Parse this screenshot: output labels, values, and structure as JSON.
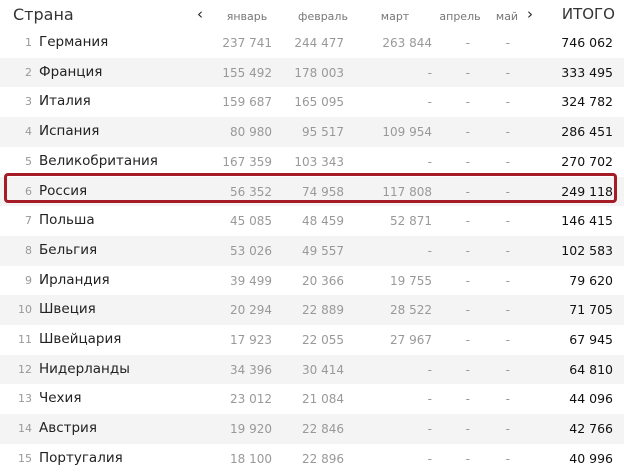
{
  "header": {
    "country": "Страна",
    "months": [
      "январь",
      "февраль",
      "март",
      "апрель",
      "май"
    ],
    "total": "ИТОГО",
    "prev_icon": "chevron-left-icon",
    "next_icon": "chevron-right-icon"
  },
  "highlight_color": "#a51b26",
  "highlighted_row": 6,
  "rows": [
    {
      "n": "1",
      "name": "Германия",
      "m": [
        "237 741",
        "244 477",
        "263 844",
        "-",
        "-"
      ],
      "total": "746 062"
    },
    {
      "n": "2",
      "name": "Франция",
      "m": [
        "155 492",
        "178 003",
        "-",
        "-",
        "-"
      ],
      "total": "333 495"
    },
    {
      "n": "3",
      "name": "Италия",
      "m": [
        "159 687",
        "165 095",
        "-",
        "-",
        "-"
      ],
      "total": "324 782"
    },
    {
      "n": "4",
      "name": "Испания",
      "m": [
        "80 980",
        "95 517",
        "109 954",
        "-",
        "-"
      ],
      "total": "286 451"
    },
    {
      "n": "5",
      "name": "Великобритания",
      "m": [
        "167 359",
        "103 343",
        "-",
        "-",
        "-"
      ],
      "total": "270 702"
    },
    {
      "n": "6",
      "name": "Россия",
      "m": [
        "56 352",
        "74 958",
        "117 808",
        "-",
        "-"
      ],
      "total": "249 118"
    },
    {
      "n": "7",
      "name": "Польша",
      "m": [
        "45 085",
        "48 459",
        "52 871",
        "-",
        "-"
      ],
      "total": "146 415"
    },
    {
      "n": "8",
      "name": "Бельгия",
      "m": [
        "53 026",
        "49 557",
        "-",
        "-",
        "-"
      ],
      "total": "102 583"
    },
    {
      "n": "9",
      "name": "Ирландия",
      "m": [
        "39 499",
        "20 366",
        "19 755",
        "-",
        "-"
      ],
      "total": "79 620"
    },
    {
      "n": "10",
      "name": "Швеция",
      "m": [
        "20 294",
        "22 889",
        "28 522",
        "-",
        "-"
      ],
      "total": "71 705"
    },
    {
      "n": "11",
      "name": "Швейцария",
      "m": [
        "17 923",
        "22 055",
        "27 967",
        "-",
        "-"
      ],
      "total": "67 945"
    },
    {
      "n": "12",
      "name": "Нидерланды",
      "m": [
        "34 396",
        "30 414",
        "-",
        "-",
        "-"
      ],
      "total": "64 810"
    },
    {
      "n": "13",
      "name": "Чехия",
      "m": [
        "23 012",
        "21 084",
        "-",
        "-",
        "-"
      ],
      "total": "44 096"
    },
    {
      "n": "14",
      "name": "Австрия",
      "m": [
        "19 920",
        "22 846",
        "-",
        "-",
        "-"
      ],
      "total": "42 766"
    },
    {
      "n": "15",
      "name": "Португалия",
      "m": [
        "18 100",
        "22 896",
        "-",
        "-",
        "-"
      ],
      "total": "40 996"
    }
  ]
}
